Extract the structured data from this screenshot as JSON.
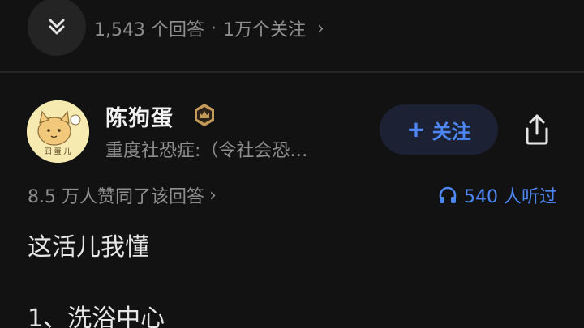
{
  "question": {
    "answers_count": "1,543 个回答",
    "separator": "·",
    "followers_count": "1万个关注",
    "chevron": "›"
  },
  "author": {
    "name": "陈狗蛋",
    "bio": "重度社恐症:（令社会恐…",
    "avatar_text": "囧 蛋 儿",
    "badge_icon": "crown-badge-icon"
  },
  "actions": {
    "follow_plus": "+",
    "follow_label": "关注"
  },
  "meta": {
    "likes": "8.5 万人赞同了该回答",
    "likes_chevron": "›",
    "listens": "540 人听过"
  },
  "content": {
    "paragraph_1": "这活儿我懂",
    "paragraph_2": "1、洗浴中心"
  },
  "colors": {
    "background": "#121212",
    "accent": "#4d86f5",
    "muted_text": "#8f8f8f",
    "badge": "#c49a5a"
  }
}
